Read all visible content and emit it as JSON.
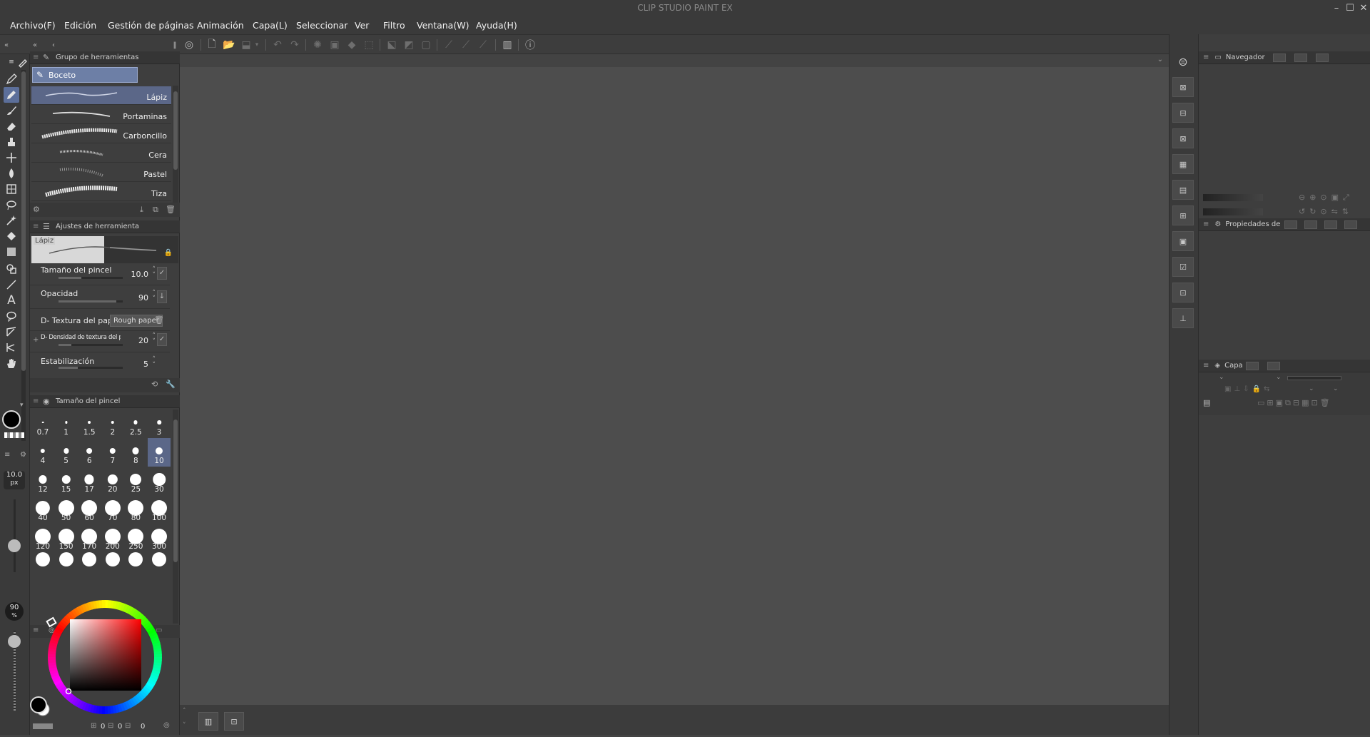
{
  "app": {
    "title": "CLIP STUDIO PAINT EX",
    "window_controls": [
      "minimize",
      "maximize",
      "close"
    ]
  },
  "menu": [
    "Archivo(F)",
    "Edición",
    "Gestión de páginas",
    "Animación",
    "Capa(L)",
    "Seleccionar",
    "Ver",
    "Filtro",
    "Ventana(W)",
    "Ayuda(H)"
  ],
  "tool_group": {
    "panel_title": "Grupo de herramientas",
    "active_group": "Boceto",
    "subtools": [
      {
        "label": "Lápiz",
        "active": true
      },
      {
        "label": "Portaminas",
        "active": false
      },
      {
        "label": "Carboncillo",
        "active": false
      },
      {
        "label": "Cera",
        "active": false
      },
      {
        "label": "Pastel",
        "active": false
      },
      {
        "label": "Tiza",
        "active": false
      }
    ]
  },
  "tool_settings": {
    "panel_title": "Ajustes de herramienta",
    "preview_label": "Lápiz",
    "rows": [
      {
        "label": "Tamaño del pincel",
        "value": "10.0",
        "fill": 0.35
      },
      {
        "label": "Opacidad",
        "value": "90",
        "fill": 0.9
      },
      {
        "label": "D- Textura del papel",
        "chip": "Rough paper"
      },
      {
        "label": "D- Densidad de textura del pa",
        "value": "20",
        "fill": 0.2
      },
      {
        "label": "Estabilización",
        "value": "5",
        "fill": 0.3
      }
    ]
  },
  "brush_size": {
    "panel_title": "Tamaño del pincel",
    "sizes": [
      "0.7",
      "1",
      "1.5",
      "2",
      "2.5",
      "3",
      "4",
      "5",
      "6",
      "7",
      "8",
      "10",
      "12",
      "15",
      "17",
      "20",
      "25",
      "30",
      "40",
      "50",
      "60",
      "70",
      "80",
      "100",
      "120",
      "150",
      "170",
      "200",
      "250",
      "300"
    ],
    "selected": "10"
  },
  "left_strip": {
    "brush_size_readout": "10.0",
    "brush_size_unit": "px",
    "opacity_readout": "90",
    "opacity_unit": "%"
  },
  "color_panel": {
    "rgb_readout": [
      "0",
      "0",
      "0"
    ],
    "main_color": "#000000",
    "sub_color": "#ffffff",
    "hue_marker": "red"
  },
  "navigator": {
    "panel_title": "Navegador"
  },
  "properties": {
    "panel_title": "Propiedades de"
  },
  "layer": {
    "panel_title": "Capa"
  },
  "colors": {
    "accent": "#5c6f9a",
    "panel_bg": "#3e3e3e",
    "canvas_bg": "#4d4d4d"
  }
}
